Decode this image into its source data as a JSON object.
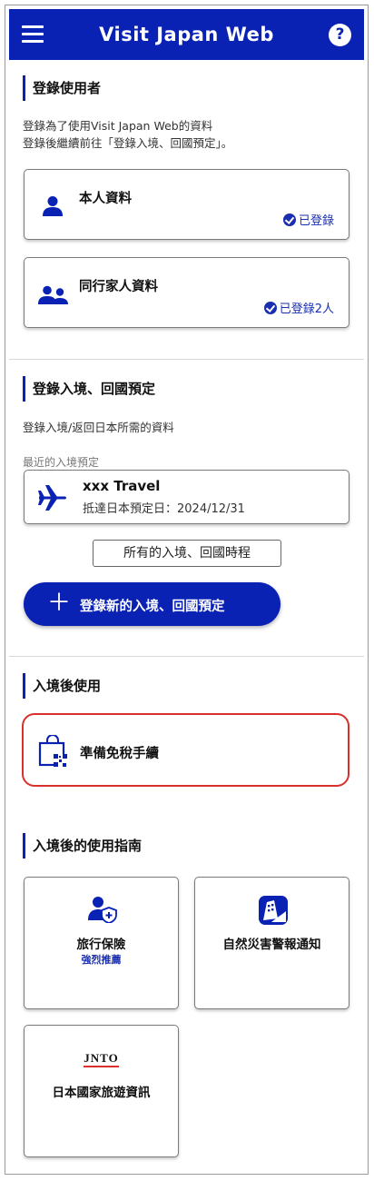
{
  "header": {
    "title": "Visit Japan Web",
    "help_glyph": "?"
  },
  "users_section": {
    "title": "登錄使用者",
    "desc_line1": "登錄為了使用Visit Japan Web的資料",
    "desc_line2": "登錄後繼續前往「登錄入境、回國預定」。",
    "self_card": {
      "label": "本人資料",
      "status": "已登錄",
      "icon": "person-icon"
    },
    "family_card": {
      "label": "同行家人資料",
      "status": "已登錄2人",
      "icon": "family-icon"
    }
  },
  "trip_section": {
    "title": "登錄入境、回國預定",
    "desc": "登錄入境/返回日本所需的資料",
    "recent_label": "最近的入境預定",
    "trip_card": {
      "name": "xxx Travel",
      "arrival": "抵達日本預定日：2024/12/31",
      "icon": "airplane-icon"
    },
    "all_trips_button": "所有的入境、回國時程",
    "new_trip_button": "登錄新的入境、回國預定",
    "new_trip_glyph": "＋"
  },
  "after_entry_section": {
    "title": "入境後使用",
    "tax_free_card": {
      "label": "準備免稅手續",
      "icon": "tax-free-bag-qr-icon"
    }
  },
  "guide_section": {
    "title": "入境後的使用指南",
    "tiles": [
      {
        "label": "旅行保險",
        "sub": "強烈推薦",
        "icon": "insurance-person-shield-icon"
      },
      {
        "label": "自然災害警報通知",
        "icon": "disaster-alert-icon"
      },
      {
        "label": "日本國家旅遊資訊",
        "logo_text": "JNTO",
        "icon": "jnto-logo"
      }
    ]
  },
  "colors": {
    "brand": "#0a22b4",
    "highlight_border": "#d9302c",
    "status_blue": "#1a2fb0"
  }
}
